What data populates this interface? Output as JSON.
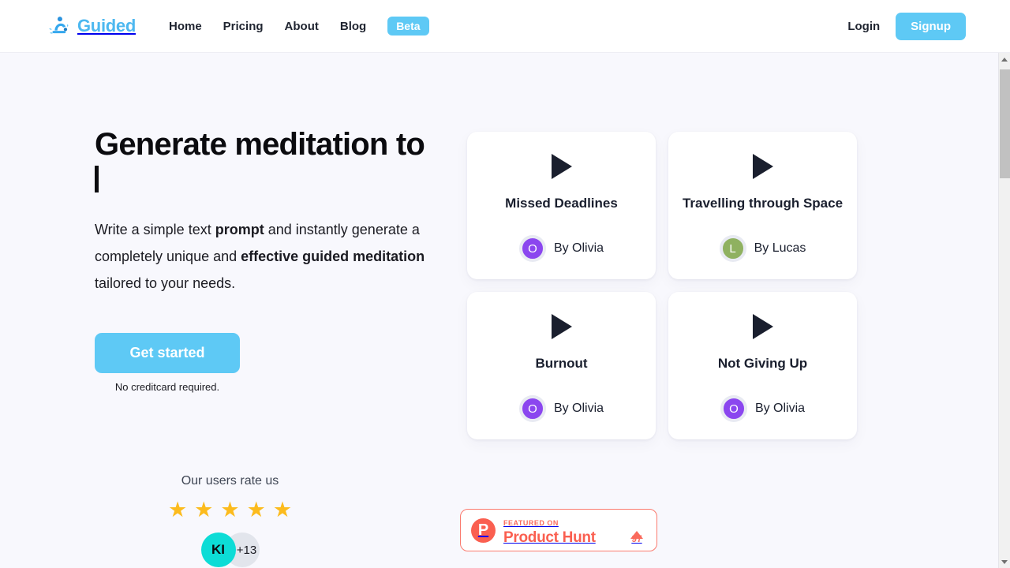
{
  "navbar": {
    "brand": "Guided",
    "logo_icon": "meditation-person-icon",
    "links": [
      {
        "label": "Home"
      },
      {
        "label": "Pricing"
      },
      {
        "label": "About"
      },
      {
        "label": "Blog"
      }
    ],
    "beta_badge": "Beta",
    "login_label": "Login",
    "signup_label": "Signup",
    "accent_color": "#5ec9f5"
  },
  "hero": {
    "title": "Generate meditation to",
    "typing_cursor": true,
    "subtitle": {
      "part1": "Write a simple text ",
      "bold1": "prompt",
      "part2": " and instantly generate a completely unique and ",
      "bold2": "effective guided meditation",
      "part3": " tailored to your needs."
    },
    "cta_label": "Get started",
    "cta_note": "No creditcard required."
  },
  "cards": [
    {
      "title": "Missed Deadlines",
      "author": "By Olivia",
      "avatar_letter": "O",
      "avatar_color": "#8b46ef",
      "play_icon": "play-icon"
    },
    {
      "title": "Travelling through Space",
      "author": "By Lucas",
      "avatar_letter": "L",
      "avatar_color": "#8fb160",
      "play_icon": "play-icon"
    },
    {
      "title": "Burnout",
      "author": "By Olivia",
      "avatar_letter": "O",
      "avatar_color": "#8b46ef",
      "play_icon": "play-icon"
    },
    {
      "title": "Not Giving Up",
      "author": "By Olivia",
      "avatar_letter": "O",
      "avatar_color": "#8b46ef",
      "play_icon": "play-icon"
    }
  ],
  "rating": {
    "label": "Our users rate us",
    "stars": [
      "★",
      "★",
      "★",
      "★",
      "★"
    ],
    "star_color": "#fcbb1d",
    "avatar_initials": "KI",
    "avatar_color": "#0ddcd6",
    "more_count": "+13"
  },
  "product_hunt": {
    "featured_on": "FEATURED ON",
    "name": "Product Hunt",
    "logo_letter": "P",
    "upvote_count": "97",
    "brand_color": "#fa5f50"
  },
  "scrollbar": {
    "up_arrow": "scroll-up-arrow",
    "down_arrow": "scroll-down-arrow"
  }
}
